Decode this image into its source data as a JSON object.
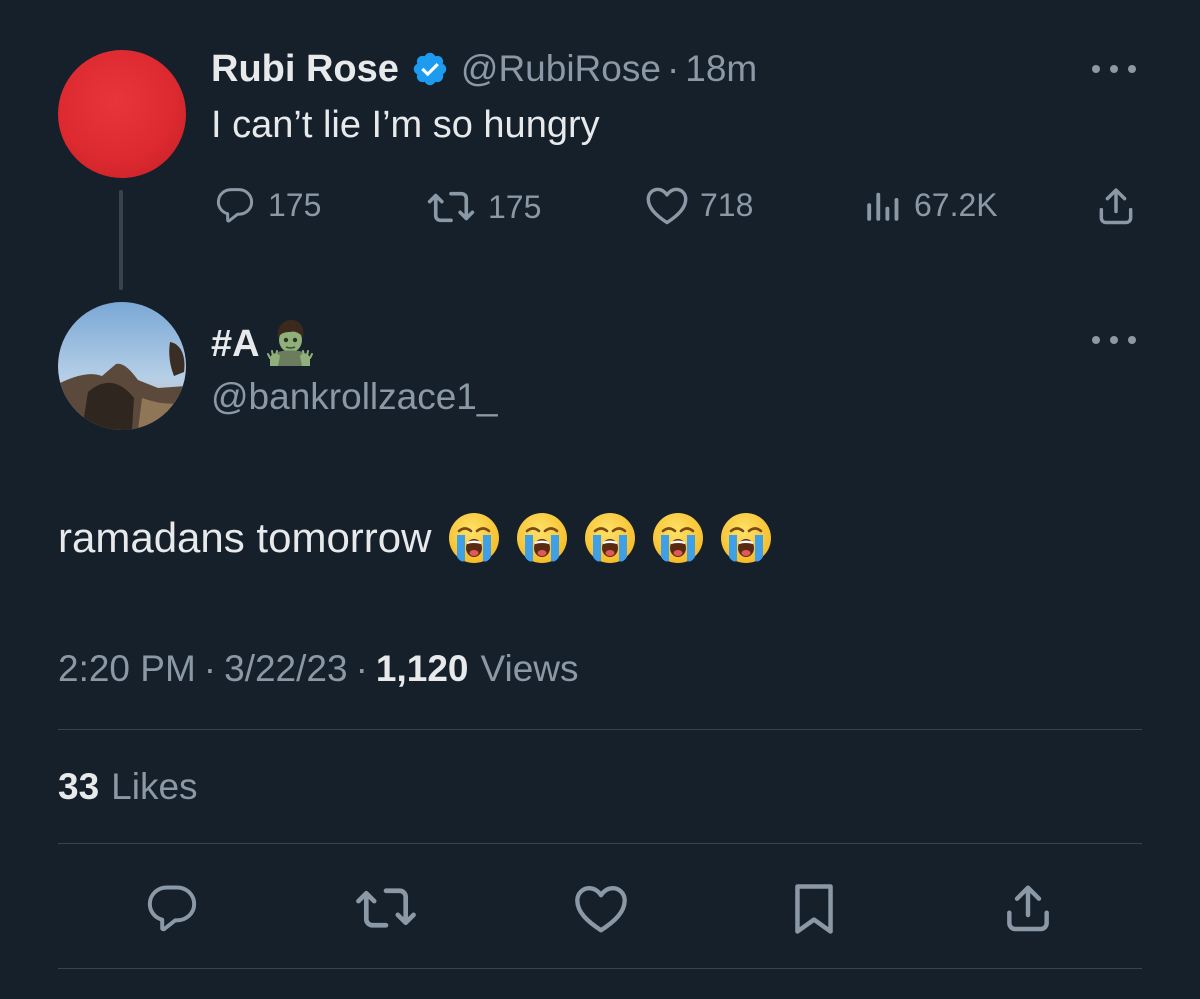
{
  "parent_tweet": {
    "display_name": "Rubi Rose",
    "handle": "@RubiRose",
    "dot": "·",
    "time_ago": "18m",
    "text": "I can’t lie I’m so hungry",
    "metrics": {
      "replies": "175",
      "retweets": "175",
      "likes": "718",
      "views": "67.2K"
    },
    "avatar_color": "#e02e34"
  },
  "reply_tweet": {
    "display_name": "#A",
    "name_emoji": "zombie-emoji",
    "handle": "@bankrollzace1_",
    "text": "ramadans tomorrow",
    "emojis": [
      "loudly-crying-face",
      "loudly-crying-face",
      "loudly-crying-face",
      "loudly-crying-face",
      "loudly-crying-face"
    ],
    "time": "2:20 PM",
    "date": "3/22/23",
    "dot": "·",
    "views_count": "1,120",
    "views_label": "Views",
    "likes_count": "33",
    "likes_label": "Likes"
  },
  "action_bar": [
    "reply-icon",
    "retweet-icon",
    "like-icon",
    "bookmark-icon",
    "share-icon"
  ],
  "colors": {
    "background": "#15202b",
    "text_primary": "#e7e9ea",
    "text_secondary": "#8b98a5",
    "divider": "#38444d",
    "verified": "#1d9bf0"
  }
}
